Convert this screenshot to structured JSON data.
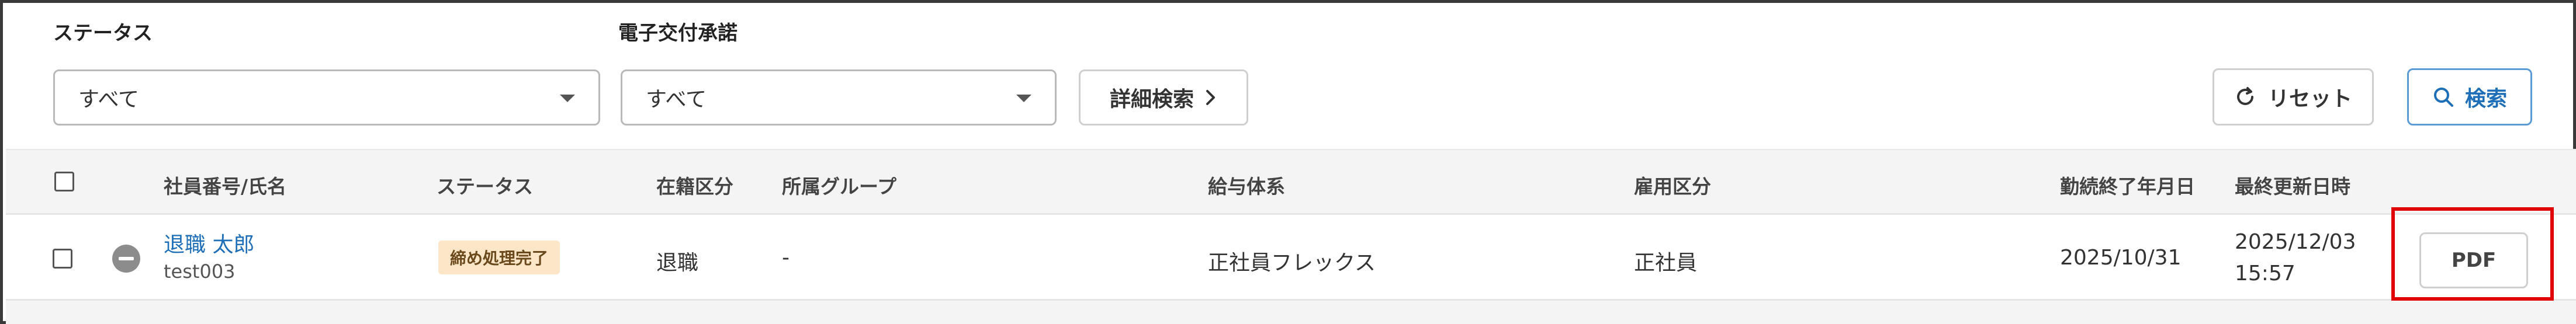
{
  "filters": {
    "status_label": "ステータス",
    "status_value": "すべて",
    "delivery_label": "電子交付承諾",
    "delivery_value": "すべて",
    "detail_search_label": "詳細検索",
    "reset_label": "リセット",
    "search_label": "検索"
  },
  "table": {
    "columns": {
      "employee": "社員番号/氏名",
      "status": "ステータス",
      "enrollment": "在籍区分",
      "group": "所属グループ",
      "pay_system": "給与体系",
      "employment_type": "雇用区分",
      "end_date": "勤続終了年月日",
      "updated_at": "最終更新日時"
    },
    "rows": [
      {
        "name": "退職 太郎",
        "employee_id": "test003",
        "status": "締め処理完了",
        "enrollment": "退職",
        "group": "-",
        "pay_system": "正社員フレックス",
        "employment_type": "正社員",
        "end_date": "2025/10/31",
        "updated_date": "2025/12/03",
        "updated_time": "15:57",
        "pdf_label": "PDF"
      }
    ]
  },
  "colors": {
    "primary": "#1f6fb8",
    "badge_bg": "#fde6c7",
    "highlight": "#e00000"
  }
}
